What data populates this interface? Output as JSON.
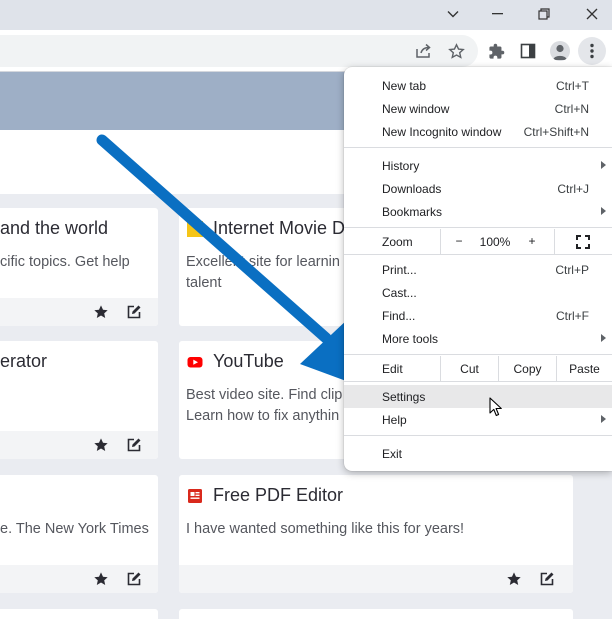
{
  "window": {
    "controls": [
      "chevron-down-icon",
      "minimize-icon",
      "restore-icon",
      "close-icon"
    ]
  },
  "toolbar": {
    "icons": [
      "share-icon",
      "star-icon",
      "extensions-icon",
      "side-panel-icon",
      "profile-icon",
      "more-vert-icon"
    ]
  },
  "cards": [
    {
      "title": "and the world",
      "desc": [
        "cific topics. Get help"
      ]
    },
    {
      "title": "Internet Movie D",
      "desc": [
        "Excellent site for learnin",
        "talent"
      ],
      "favicon_color": "#f5c518"
    },
    {
      "title": "erator",
      "desc": []
    },
    {
      "title": "YouTube",
      "desc": [
        "Best video site. Find clip",
        "Learn how to fix anythin"
      ],
      "favicon_color": "#ff0000"
    },
    {
      "title": "",
      "desc": [
        "e. The New York Times"
      ]
    },
    {
      "title": "Free PDF Editor",
      "desc": [
        "I have wanted something like this for years!"
      ],
      "favicon_color": "#d9291c"
    }
  ],
  "menu": {
    "new_tab": {
      "label": "New tab",
      "shortcut": "Ctrl+T"
    },
    "new_window": {
      "label": "New window",
      "shortcut": "Ctrl+N"
    },
    "incognito": {
      "label": "New Incognito window",
      "shortcut": "Ctrl+Shift+N"
    },
    "history": {
      "label": "History"
    },
    "downloads": {
      "label": "Downloads",
      "shortcut": "Ctrl+J"
    },
    "bookmarks": {
      "label": "Bookmarks"
    },
    "zoom": {
      "label": "Zoom",
      "minus": "−",
      "value": "100%",
      "plus": "+"
    },
    "print": {
      "label": "Print...",
      "shortcut": "Ctrl+P"
    },
    "cast": {
      "label": "Cast..."
    },
    "find": {
      "label": "Find...",
      "shortcut": "Ctrl+F"
    },
    "more_tools": {
      "label": "More tools"
    },
    "edit": {
      "label": "Edit",
      "cut": "Cut",
      "copy": "Copy",
      "paste": "Paste"
    },
    "settings": {
      "label": "Settings"
    },
    "help": {
      "label": "Help"
    },
    "exit": {
      "label": "Exit"
    }
  },
  "colors": {
    "arrow": "#0a6fc2",
    "banner": "#9eafc6",
    "highlight": "#e8e8e9"
  }
}
